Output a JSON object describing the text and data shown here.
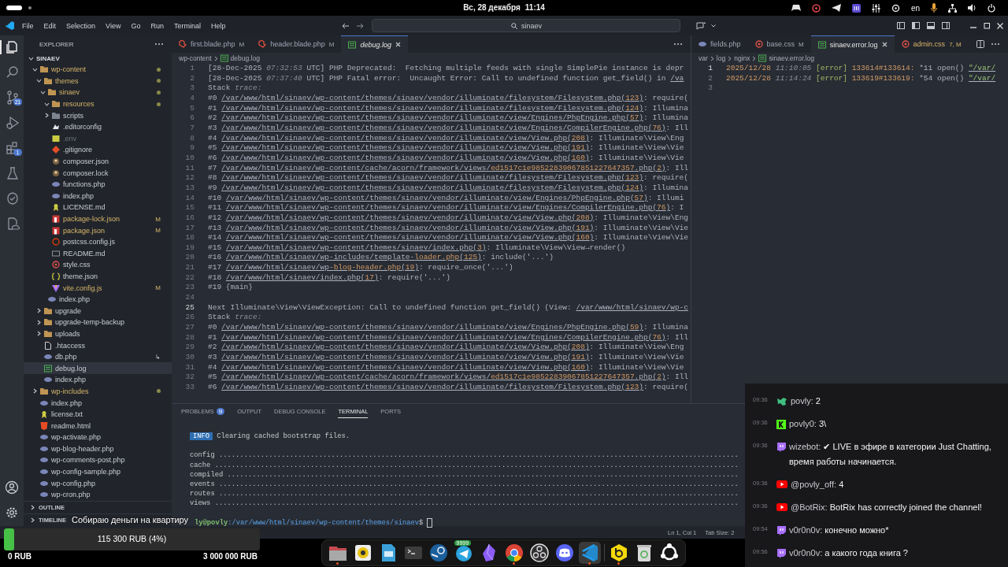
{
  "top_bar": {
    "date": "Вс, 28 декабря",
    "time": "11:14",
    "keyboard_layout": "en"
  },
  "title_bar": {
    "menu": [
      "File",
      "Edit",
      "Selection",
      "View",
      "Go",
      "Run",
      "Terminal",
      "Help"
    ],
    "search": "sinaev"
  },
  "activity_bar": {
    "items": [
      {
        "kind": "explorer",
        "selected": true
      },
      {
        "kind": "search",
        "selected": false
      },
      {
        "kind": "source-control",
        "selected": false,
        "badge": "21"
      },
      {
        "kind": "run",
        "selected": false
      },
      {
        "kind": "extensions",
        "selected": false,
        "badge": "1"
      },
      {
        "kind": "testing",
        "selected": false
      },
      {
        "kind": "remote",
        "selected": false
      },
      {
        "kind": "docs",
        "selected": false
      }
    ]
  },
  "sidebar": {
    "title": "EXPLORER",
    "root": "SINAEV",
    "tree": [
      {
        "label": "wp-content",
        "kind": "folder",
        "expanded": true,
        "modified": true,
        "ignored": false,
        "selected": false,
        "children": [
          {
            "label": "themes",
            "kind": "folder",
            "expanded": true,
            "modified": true,
            "ignored": false,
            "selected": false,
            "children": [
              {
                "label": "sinaev",
                "kind": "folder",
                "expanded": true,
                "modified": true,
                "ignored": false,
                "selected": false,
                "children": [
                  {
                    "label": "resources",
                    "kind": "folder",
                    "expanded": true,
                    "modified": true,
                    "ignored": false,
                    "selected": false
                  },
                  {
                    "label": "scripts",
                    "kind": "folder-script",
                    "expanded": false,
                    "modified": false,
                    "ignored": false,
                    "selected": false
                  },
                  {
                    "label": ".editorconfig",
                    "kind": "editorconfig",
                    "modified": false,
                    "ignored": false,
                    "selected": false
                  },
                  {
                    "label": ".env",
                    "kind": "env",
                    "modified": false,
                    "ignored": true,
                    "selected": false
                  },
                  {
                    "label": ".gitignore",
                    "kind": "git",
                    "modified": false,
                    "ignored": false,
                    "selected": false
                  },
                  {
                    "label": "composer.json",
                    "kind": "composer",
                    "modified": false,
                    "ignored": false,
                    "selected": false
                  },
                  {
                    "label": "composer.lock",
                    "kind": "composer",
                    "modified": false,
                    "ignored": false,
                    "selected": false
                  },
                  {
                    "label": "functions.php",
                    "kind": "php",
                    "modified": false,
                    "ignored": false,
                    "selected": false
                  },
                  {
                    "label": "index.php",
                    "kind": "php",
                    "modified": false,
                    "ignored": false,
                    "selected": false
                  },
                  {
                    "label": "LICENSE.md",
                    "kind": "license",
                    "modified": false,
                    "ignored": false,
                    "selected": false
                  },
                  {
                    "label": "package-lock.json",
                    "kind": "npm",
                    "modified": true,
                    "ignored": false,
                    "selected": false,
                    "badge": "M"
                  },
                  {
                    "label": "package.json",
                    "kind": "npm",
                    "modified": true,
                    "ignored": false,
                    "selected": false,
                    "badge": "M"
                  },
                  {
                    "label": "postcss.config.js",
                    "kind": "postcss",
                    "modified": false,
                    "ignored": false,
                    "selected": false
                  },
                  {
                    "label": "README.md",
                    "kind": "md",
                    "modified": false,
                    "ignored": false,
                    "selected": false
                  },
                  {
                    "label": "style.css",
                    "kind": "css",
                    "modified": false,
                    "ignored": false,
                    "selected": false
                  },
                  {
                    "label": "theme.json",
                    "kind": "json",
                    "modified": false,
                    "ignored": false,
                    "selected": false
                  },
                  {
                    "label": "vite.config.js",
                    "kind": "vite",
                    "modified": true,
                    "ignored": false,
                    "selected": false,
                    "badge": "M"
                  }
                ]
              },
              {
                "label": "index.php",
                "kind": "php",
                "modified": false,
                "ignored": false,
                "selected": false
              }
            ]
          },
          {
            "label": "upgrade",
            "kind": "folder",
            "expanded": false,
            "modified": false,
            "ignored": false,
            "selected": false
          },
          {
            "label": "upgrade-temp-backup",
            "kind": "folder",
            "expanded": false,
            "modified": false,
            "ignored": false,
            "selected": false
          },
          {
            "label": "uploads",
            "kind": "folder",
            "expanded": false,
            "modified": false,
            "ignored": false,
            "selected": false
          },
          {
            "label": ".htaccess",
            "kind": "page",
            "modified": false,
            "ignored": false,
            "selected": false
          },
          {
            "label": "db.php",
            "kind": "php",
            "modified": false,
            "ignored": false,
            "selected": false,
            "suffix": "↳"
          },
          {
            "label": "debug.log",
            "kind": "log",
            "modified": false,
            "ignored": false,
            "selected": true
          },
          {
            "label": "index.php",
            "kind": "php",
            "modified": false,
            "ignored": false,
            "selected": false
          }
        ]
      },
      {
        "label": "wp-includes",
        "kind": "folder",
        "expanded": false,
        "modified": true,
        "ignored": false,
        "selected": false
      },
      {
        "label": "index.php",
        "kind": "php",
        "modified": false,
        "ignored": false,
        "selected": false
      },
      {
        "label": "license.txt",
        "kind": "license",
        "modified": false,
        "ignored": false,
        "selected": false
      },
      {
        "label": "readme.html",
        "kind": "html",
        "modified": false,
        "ignored": false,
        "selected": false
      },
      {
        "label": "wp-activate.php",
        "kind": "php",
        "modified": false,
        "ignored": false,
        "selected": false
      },
      {
        "label": "wp-blog-header.php",
        "kind": "php",
        "modified": false,
        "ignored": false,
        "selected": false
      },
      {
        "label": "wp-comments-post.php",
        "kind": "php",
        "modified": false,
        "ignored": false,
        "selected": false
      },
      {
        "label": "wp-config-sample.php",
        "kind": "php",
        "modified": false,
        "ignored": false,
        "selected": false
      },
      {
        "label": "wp-config.php",
        "kind": "php",
        "modified": false,
        "ignored": false,
        "selected": false
      },
      {
        "label": "wp-cron.php",
        "kind": "php",
        "modified": false,
        "ignored": false,
        "selected": false
      }
    ],
    "sections": [
      "OUTLINE",
      "TIMELINE"
    ]
  },
  "editors": [
    {
      "tabs": [
        {
          "label": "first.blade.php",
          "kind": "blade",
          "badge": "M",
          "selected": false,
          "preview": false,
          "warning": false
        },
        {
          "label": "header.blade.php",
          "kind": "blade",
          "badge": "M",
          "selected": false,
          "preview": false,
          "warning": false
        },
        {
          "label": "debug.log",
          "kind": "log",
          "selected": true,
          "preview": true,
          "warning": false
        }
      ],
      "breadcrumbs": [
        {
          "label": "wp-content",
          "kind": "dir"
        },
        {
          "label": "debug.log",
          "kind": "log"
        }
      ],
      "lines": [
        {
          "n": "1",
          "current": false,
          "spans": [
            {
              "kind": "plain",
              "text": "[28-Dec-2025 "
            },
            {
              "kind": "dim",
              "text": "07:32:53"
            },
            {
              "kind": "plain",
              "text": " UTC] PHP Deprecated:  Fetching multiple feeds with single SimplePie instance is depr"
            }
          ]
        },
        {
          "n": "2",
          "current": false,
          "spans": [
            {
              "kind": "plain",
              "text": "[28-Dec-2025 "
            },
            {
              "kind": "dim",
              "text": "07:37:40"
            },
            {
              "kind": "plain",
              "text": " UTC] PHP Fatal error:  Uncaught Error: Call to undefined function get_field() in "
            },
            {
              "kind": "link",
              "text": "/va"
            }
          ]
        },
        {
          "n": "3",
          "current": false,
          "spans": [
            {
              "kind": "plain",
              "text": "Stack "
            },
            {
              "kind": "dim",
              "text": "trace:"
            }
          ]
        },
        {
          "n": "4",
          "current": false,
          "spans": [
            {
              "kind": "plain",
              "text": "#0 "
            },
            {
              "kind": "link",
              "text": "/var/www/html/sinaev/wp-content/themes/sinaev/vendor/illuminate/filesystem/Filesystem.php("
            },
            {
              "kind": "link-num",
              "text": "123"
            },
            {
              "kind": "link",
              "text": ")"
            },
            {
              "kind": "plain",
              "text": ": require("
            }
          ]
        },
        {
          "n": "5",
          "current": false,
          "spans": [
            {
              "kind": "plain",
              "text": "#1 "
            },
            {
              "kind": "link",
              "text": "/var/www/html/sinaev/wp-content/themes/sinaev/vendor/illuminate/filesystem/Filesystem.php("
            },
            {
              "kind": "link-num",
              "text": "124"
            },
            {
              "kind": "link",
              "text": ")"
            },
            {
              "kind": "plain",
              "text": ": Illumina"
            }
          ]
        },
        {
          "n": "6",
          "current": false,
          "spans": [
            {
              "kind": "plain",
              "text": "#2 "
            },
            {
              "kind": "link",
              "text": "/var/www/html/sinaev/wp-content/themes/sinaev/vendor/illuminate/view/Engines/PhpEngine.php("
            },
            {
              "kind": "link-num",
              "text": "57"
            },
            {
              "kind": "link",
              "text": ")"
            },
            {
              "kind": "plain",
              "text": ": Illumina"
            }
          ]
        },
        {
          "n": "7",
          "current": false,
          "spans": [
            {
              "kind": "plain",
              "text": "#3 "
            },
            {
              "kind": "link",
              "text": "/var/www/html/sinaev/wp-content/themes/sinaev/vendor/illuminate/view/Engines/CompilerEngine.php("
            },
            {
              "kind": "link-num",
              "text": "76"
            },
            {
              "kind": "link",
              "text": ")"
            },
            {
              "kind": "plain",
              "text": ": Ill"
            }
          ]
        },
        {
          "n": "8",
          "current": false,
          "spans": [
            {
              "kind": "plain",
              "text": "#4 "
            },
            {
              "kind": "link",
              "text": "/var/www/html/sinaev/wp-content/themes/sinaev/vendor/illuminate/view/View.php("
            },
            {
              "kind": "link-num",
              "text": "208"
            },
            {
              "kind": "link",
              "text": ")"
            },
            {
              "kind": "plain",
              "text": ": Illuminate\\View\\Eng"
            }
          ]
        },
        {
          "n": "9",
          "current": false,
          "spans": [
            {
              "kind": "plain",
              "text": "#5 "
            },
            {
              "kind": "link",
              "text": "/var/www/html/sinaev/wp-content/themes/sinaev/vendor/illuminate/view/View.php("
            },
            {
              "kind": "link-num",
              "text": "191"
            },
            {
              "kind": "link",
              "text": ")"
            },
            {
              "kind": "plain",
              "text": ": Illuminate\\View\\Vie"
            }
          ]
        },
        {
          "n": "10",
          "current": false,
          "spans": [
            {
              "kind": "plain",
              "text": "#6 "
            },
            {
              "kind": "link",
              "text": "/var/www/html/sinaev/wp-content/themes/sinaev/vendor/illuminate/view/View.php("
            },
            {
              "kind": "link-num",
              "text": "160"
            },
            {
              "kind": "link",
              "text": ")"
            },
            {
              "kind": "plain",
              "text": ": Illuminate\\View\\Vie"
            }
          ]
        },
        {
          "n": "11",
          "current": false,
          "spans": [
            {
              "kind": "plain",
              "text": "#7 "
            },
            {
              "kind": "link",
              "text": "/var/www/html/sinaev/wp-content/cache/acorn/framework/views/"
            },
            {
              "kind": "link-num",
              "text": "ed1517c1e98522839067851227647357"
            },
            {
              "kind": "link",
              "text": ".php("
            },
            {
              "kind": "link-num",
              "text": "2"
            },
            {
              "kind": "link",
              "text": ")"
            },
            {
              "kind": "plain",
              "text": ": Ill"
            }
          ]
        },
        {
          "n": "12",
          "current": false,
          "spans": [
            {
              "kind": "plain",
              "text": "#8 "
            },
            {
              "kind": "link",
              "text": "/var/www/html/sinaev/wp-content/themes/sinaev/vendor/illuminate/filesystem/Filesystem.php("
            },
            {
              "kind": "link-num",
              "text": "123"
            },
            {
              "kind": "link",
              "text": ")"
            },
            {
              "kind": "plain",
              "text": ": require("
            }
          ]
        },
        {
          "n": "13",
          "current": false,
          "spans": [
            {
              "kind": "plain",
              "text": "#9 "
            },
            {
              "kind": "link",
              "text": "/var/www/html/sinaev/wp-content/themes/sinaev/vendor/illuminate/filesystem/Filesystem.php("
            },
            {
              "kind": "link-num",
              "text": "124"
            },
            {
              "kind": "link",
              "text": ")"
            },
            {
              "kind": "plain",
              "text": ": Illumina"
            }
          ]
        },
        {
          "n": "14",
          "current": false,
          "spans": [
            {
              "kind": "plain",
              "text": "#10 "
            },
            {
              "kind": "link",
              "text": "/var/www/html/sinaev/wp-content/themes/sinaev/vendor/illuminate/view/Engines/PhpEngine.php("
            },
            {
              "kind": "link-num",
              "text": "57"
            },
            {
              "kind": "link",
              "text": ")"
            },
            {
              "kind": "plain",
              "text": ": Illumi"
            }
          ]
        },
        {
          "n": "15",
          "current": false,
          "spans": [
            {
              "kind": "plain",
              "text": "#11 "
            },
            {
              "kind": "link",
              "text": "/var/www/html/sinaev/wp-content/themes/sinaev/vendor/illuminate/view/Engines/CompilerEngine.php("
            },
            {
              "kind": "link-num",
              "text": "76"
            },
            {
              "kind": "link",
              "text": ")"
            },
            {
              "kind": "plain",
              "text": ": I"
            }
          ]
        },
        {
          "n": "16",
          "current": false,
          "spans": [
            {
              "kind": "plain",
              "text": "#12 "
            },
            {
              "kind": "link",
              "text": "/var/www/html/sinaev/wp-content/themes/sinaev/vendor/illuminate/view/View.php("
            },
            {
              "kind": "link-num",
              "text": "208"
            },
            {
              "kind": "link",
              "text": ")"
            },
            {
              "kind": "plain",
              "text": ": Illuminate\\View\\Eng"
            }
          ]
        },
        {
          "n": "17",
          "current": false,
          "spans": [
            {
              "kind": "plain",
              "text": "#13 "
            },
            {
              "kind": "link",
              "text": "/var/www/html/sinaev/wp-content/themes/sinaev/vendor/illuminate/view/View.php("
            },
            {
              "kind": "link-num",
              "text": "191"
            },
            {
              "kind": "link",
              "text": ")"
            },
            {
              "kind": "plain",
              "text": ": Illuminate\\View\\Vie"
            }
          ]
        },
        {
          "n": "18",
          "current": false,
          "spans": [
            {
              "kind": "plain",
              "text": "#14 "
            },
            {
              "kind": "link",
              "text": "/var/www/html/sinaev/wp-content/themes/sinaev/vendor/illuminate/view/View.php("
            },
            {
              "kind": "link-num",
              "text": "160"
            },
            {
              "kind": "link",
              "text": ")"
            },
            {
              "kind": "plain",
              "text": ": Illuminate\\View\\Vie"
            }
          ]
        },
        {
          "n": "19",
          "current": false,
          "spans": [
            {
              "kind": "plain",
              "text": "#15 "
            },
            {
              "kind": "link",
              "text": "/var/www/html/sinaev/wp-content/themes/sinaev/index.php("
            },
            {
              "kind": "link-num",
              "text": "3"
            },
            {
              "kind": "link",
              "text": ")"
            },
            {
              "kind": "plain",
              "text": ": Illuminate\\View\\View→render()"
            }
          ]
        },
        {
          "n": "20",
          "current": false,
          "spans": [
            {
              "kind": "plain",
              "text": "#16 "
            },
            {
              "kind": "link",
              "text": "/var/www/html/sinaev/wp-includes/template-"
            },
            {
              "kind": "link-num",
              "text": "loader.php"
            },
            {
              "kind": "link",
              "text": "("
            },
            {
              "kind": "link-num",
              "text": "125"
            },
            {
              "kind": "link",
              "text": ")"
            },
            {
              "kind": "plain",
              "text": ": include('...')"
            }
          ]
        },
        {
          "n": "21",
          "current": false,
          "spans": [
            {
              "kind": "plain",
              "text": "#17 "
            },
            {
              "kind": "link",
              "text": "/var/www/html/sinaev/wp-"
            },
            {
              "kind": "link-num",
              "text": "blog-header.php"
            },
            {
              "kind": "link",
              "text": "("
            },
            {
              "kind": "link-num",
              "text": "19"
            },
            {
              "kind": "link",
              "text": ")"
            },
            {
              "kind": "plain",
              "text": ": require_once('...')"
            }
          ]
        },
        {
          "n": "22",
          "current": false,
          "spans": [
            {
              "kind": "plain",
              "text": "#18 "
            },
            {
              "kind": "link",
              "text": "/var/www/html/sinaev/index.php("
            },
            {
              "kind": "link-num",
              "text": "17"
            },
            {
              "kind": "link",
              "text": ")"
            },
            {
              "kind": "plain",
              "text": ": require('...')"
            }
          ]
        },
        {
          "n": "23",
          "current": false,
          "spans": [
            {
              "kind": "plain",
              "text": "#19 {main}"
            }
          ]
        },
        {
          "n": "24",
          "current": false
        },
        {
          "n": "25",
          "current": true,
          "spans": [
            {
              "kind": "plain",
              "text": "Next Illuminate\\View\\ViewException: Call to undefined function get_field() (View: "
            },
            {
              "kind": "link",
              "text": "/var/www/html/sinaev/wp-c"
            }
          ]
        },
        {
          "n": "26",
          "current": false,
          "spans": [
            {
              "kind": "plain",
              "text": "Stack "
            },
            {
              "kind": "dim",
              "text": "trace:"
            }
          ]
        },
        {
          "n": "27",
          "current": false,
          "spans": [
            {
              "kind": "plain",
              "text": "#0 "
            },
            {
              "kind": "link",
              "text": "/var/www/html/sinaev/wp-content/themes/sinaev/vendor/illuminate/view/Engines/PhpEngine.php("
            },
            {
              "kind": "link-num",
              "text": "59"
            },
            {
              "kind": "link",
              "text": ")"
            },
            {
              "kind": "plain",
              "text": ": Illumina"
            }
          ]
        },
        {
          "n": "28",
          "current": false,
          "spans": [
            {
              "kind": "plain",
              "text": "#1 "
            },
            {
              "kind": "link",
              "text": "/var/www/html/sinaev/wp-content/themes/sinaev/vendor/illuminate/view/Engines/CompilerEngine.php("
            },
            {
              "kind": "link-num",
              "text": "76"
            },
            {
              "kind": "link",
              "text": ")"
            },
            {
              "kind": "plain",
              "text": ": Ill"
            }
          ]
        },
        {
          "n": "29",
          "current": false,
          "spans": [
            {
              "kind": "plain",
              "text": "#2 "
            },
            {
              "kind": "link",
              "text": "/var/www/html/sinaev/wp-content/themes/sinaev/vendor/illuminate/view/View.php("
            },
            {
              "kind": "link-num",
              "text": "208"
            },
            {
              "kind": "link",
              "text": ")"
            },
            {
              "kind": "plain",
              "text": ": Illuminate\\View\\Eng"
            }
          ]
        },
        {
          "n": "30",
          "current": false,
          "spans": [
            {
              "kind": "plain",
              "text": "#3 "
            },
            {
              "kind": "link",
              "text": "/var/www/html/sinaev/wp-content/themes/sinaev/vendor/illuminate/view/View.php("
            },
            {
              "kind": "link-num",
              "text": "191"
            },
            {
              "kind": "link",
              "text": ")"
            },
            {
              "kind": "plain",
              "text": ": Illuminate\\View\\Vie"
            }
          ]
        },
        {
          "n": "31",
          "current": false,
          "spans": [
            {
              "kind": "plain",
              "text": "#4 "
            },
            {
              "kind": "link",
              "text": "/var/www/html/sinaev/wp-content/themes/sinaev/vendor/illuminate/view/View.php("
            },
            {
              "kind": "link-num",
              "text": "160"
            },
            {
              "kind": "link",
              "text": ")"
            },
            {
              "kind": "plain",
              "text": ": Illuminate\\View\\Vie"
            }
          ]
        },
        {
          "n": "32",
          "current": false,
          "spans": [
            {
              "kind": "plain",
              "text": "#5 "
            },
            {
              "kind": "link",
              "text": "/var/www/html/sinaev/wp-content/cache/acorn/framework/views/"
            },
            {
              "kind": "link-num",
              "text": "ed1517c1e98522839067851227647357"
            },
            {
              "kind": "link",
              "text": ".php("
            },
            {
              "kind": "link-num",
              "text": "2"
            },
            {
              "kind": "link",
              "text": ")"
            },
            {
              "kind": "plain",
              "text": ": Ill"
            }
          ]
        },
        {
          "n": "33",
          "current": false,
          "spans": [
            {
              "kind": "plain",
              "text": "#6 "
            },
            {
              "kind": "link",
              "text": "/var/www/html/sinaev/wp-content/themes/sinaev/vendor/illuminate/filesystem/Filesystem.php("
            },
            {
              "kind": "link-num",
              "text": "123"
            },
            {
              "kind": "link",
              "text": ")"
            },
            {
              "kind": "plain",
              "text": ": require("
            }
          ]
        }
      ]
    },
    {
      "tabs": [
        {
          "label": "fields.php",
          "kind": "php",
          "selected": false,
          "preview": false,
          "warning": false
        },
        {
          "label": "base.css",
          "kind": "css",
          "badge": "M",
          "selected": false,
          "preview": false,
          "warning": false
        },
        {
          "label": "sinaev.error.log",
          "kind": "log",
          "selected": true,
          "preview": false,
          "warning": false
        },
        {
          "label": "admin.css",
          "kind": "css",
          "badge": "7, M",
          "selected": false,
          "preview": false,
          "warning": true
        }
      ],
      "breadcrumbs": [
        {
          "label": "var",
          "kind": "dir"
        },
        {
          "label": "log",
          "kind": "dir"
        },
        {
          "label": "nginx",
          "kind": "dir"
        },
        {
          "label": "sinaev.error.log",
          "kind": "log"
        }
      ],
      "lines": [
        {
          "n": "1",
          "current": true,
          "spans": [
            {
              "kind": "num",
              "text": "2025/12/28"
            },
            {
              "kind": "dim",
              "text": " 11:10:05 "
            },
            {
              "kind": "tag",
              "text": "[error]"
            },
            {
              "kind": "num",
              "text": " 133614#133614:"
            },
            {
              "kind": "plain",
              "text": " *11 open() "
            },
            {
              "kind": "link-str",
              "text": "\"/var/"
            }
          ]
        },
        {
          "n": "2",
          "current": false,
          "spans": [
            {
              "kind": "num",
              "text": "2025/12/28"
            },
            {
              "kind": "dim",
              "text": " 11:14:24 "
            },
            {
              "kind": "tag",
              "text": "[error]"
            },
            {
              "kind": "num",
              "text": " 133619#133619:"
            },
            {
              "kind": "plain",
              "text": " *54 open() "
            },
            {
              "kind": "link-str",
              "text": "\"/var/"
            }
          ]
        },
        {
          "n": "3",
          "current": false
        }
      ]
    }
  ],
  "panel": {
    "tabs": [
      {
        "label": "PROBLEMS",
        "badge": "9",
        "selected": false
      },
      {
        "label": "OUTPUT",
        "selected": false
      },
      {
        "label": "DEBUG CONSOLE",
        "selected": false
      },
      {
        "label": "TERMINAL",
        "selected": true
      },
      {
        "label": "PORTS",
        "selected": false
      }
    ],
    "terminal": {
      "info_badge": "INFO",
      "info_text": "Clearing cached bootstrap files.",
      "task_lines": [
        "config .............................................................................................................................",
        "cache ..............................................................................................................................",
        "compiled ...........................................................................................................................",
        "events .............................................................................................................................",
        "routes .............................................................................................................................",
        "views .............................................................................................................................."
      ],
      "prompt_user": "ly@povly",
      "prompt_path": ":/var/www/html/sinaev/wp-content/themes/sinaev",
      "prompt_char": "$"
    }
  },
  "status_bar": {
    "items": [
      "Ln 1, Col 1",
      "Tab Size: 2"
    ]
  },
  "donation": {
    "title": "Собираю деньги на квартиру",
    "level": 0.04,
    "amount": "115 300 RUB (4%)",
    "min": "0 RUB",
    "max": "3 000 000 RUB"
  },
  "chat": {
    "messages": [
      {
        "time": "09:36",
        "kind": "mascot",
        "user": "povly:",
        "text": "2"
      },
      {
        "time": "09:36",
        "kind": "kick",
        "user": "povly0:",
        "text": "3\\"
      },
      {
        "time": "09:36",
        "kind": "twitch",
        "user": "wizebot:",
        "text": "✔ LIVE в эфире в категории Just Chatting, время работы начинается."
      },
      {
        "time": "09:36",
        "kind": "youtube",
        "user": "@povly_off:",
        "text": "4"
      },
      {
        "time": "09:36",
        "kind": "youtube",
        "user": "@BotRix:",
        "text": "BotRix has correctly joined the channel!"
      },
      {
        "time": "09:54",
        "kind": "twitch",
        "user": "v0r0n0v:",
        "text": "конечно можно*"
      },
      {
        "time": "09:56",
        "kind": "twitch",
        "user": "v0r0n0v:",
        "text": "а какого года книга ?"
      }
    ]
  },
  "dock": {
    "items": [
      {
        "kind": "files",
        "running": true,
        "selected": false
      },
      {
        "kind": "music",
        "running": false,
        "selected": false
      },
      {
        "kind": "docs",
        "running": false,
        "selected": false
      },
      {
        "kind": "terminal",
        "running": false,
        "selected": false
      },
      {
        "kind": "steam",
        "running": false,
        "selected": false
      },
      {
        "kind": "telegram",
        "running": false,
        "selected": false,
        "badge": "9999"
      },
      {
        "kind": "gem",
        "running": false,
        "selected": false
      },
      {
        "kind": "chrome",
        "running": true,
        "selected": false
      },
      {
        "kind": "obs",
        "running": false,
        "selected": false
      },
      {
        "kind": "discord",
        "running": false,
        "selected": false
      },
      {
        "kind": "vscode",
        "running": true,
        "selected": true
      },
      {
        "kind": "separator"
      },
      {
        "kind": "bee",
        "running": true,
        "selected": false
      },
      {
        "kind": "trash",
        "running": false,
        "selected": false
      },
      {
        "kind": "apps",
        "running": false,
        "selected": false
      }
    ]
  }
}
